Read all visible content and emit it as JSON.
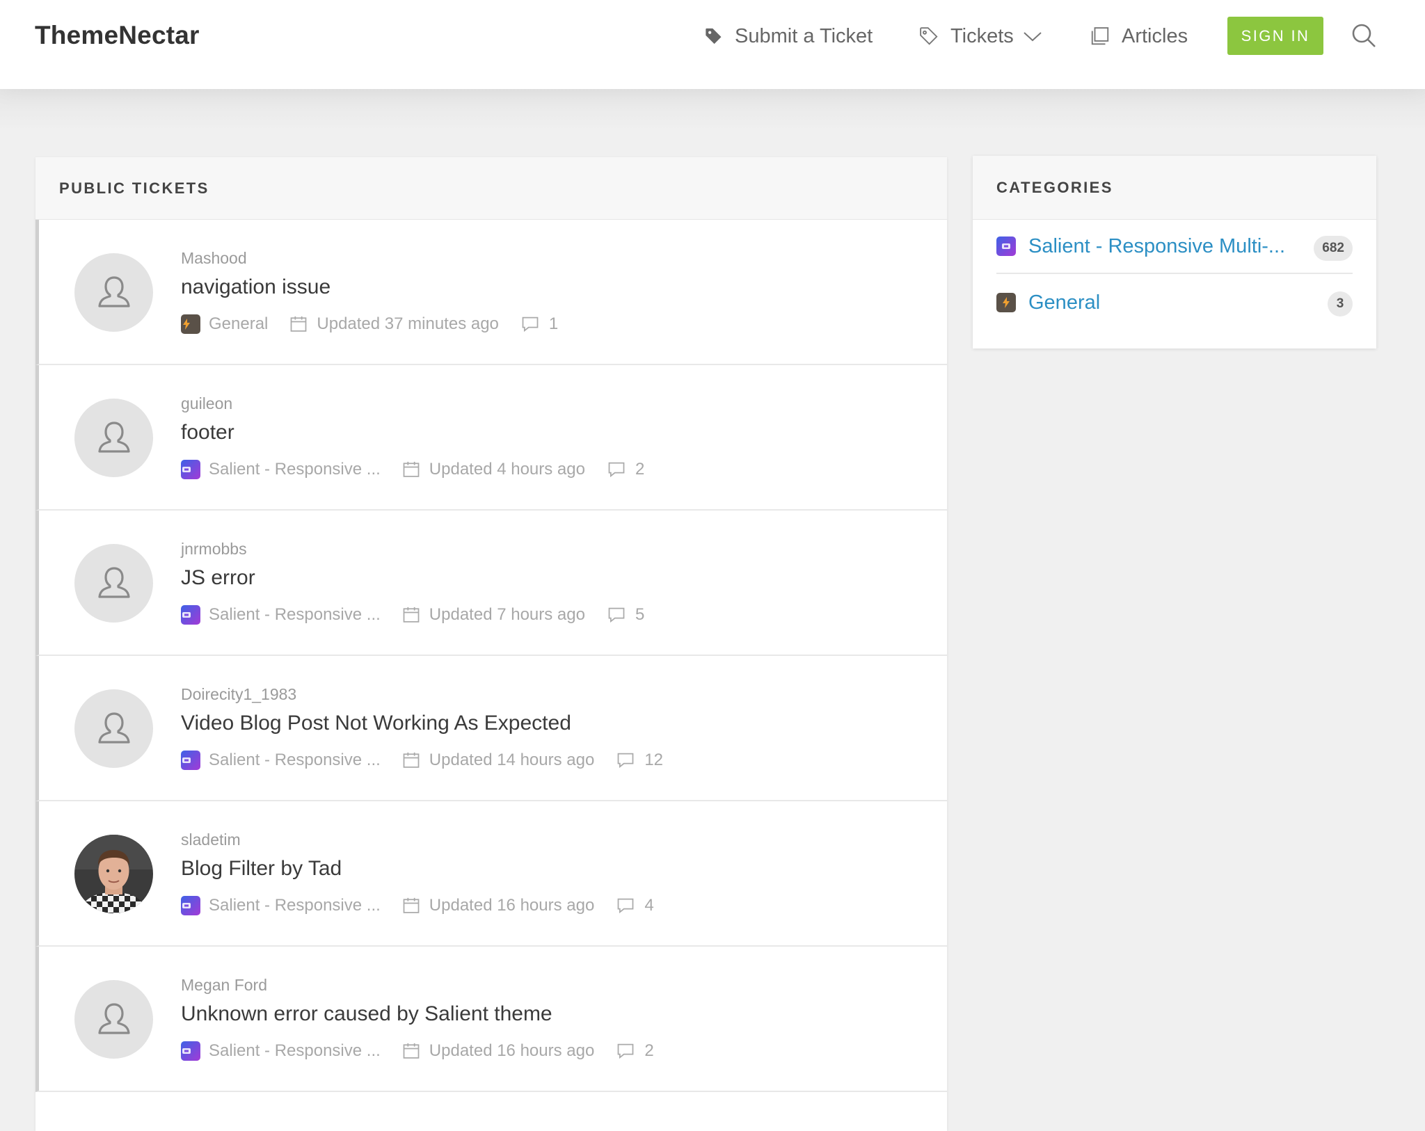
{
  "header": {
    "logo": "ThemeNectar",
    "nav": {
      "submit": "Submit a Ticket",
      "tickets": "Tickets",
      "articles": "Articles"
    },
    "signin": "SIGN IN",
    "colors": {
      "signin_bg": "#8cc63f",
      "link": "#2c8fc4"
    }
  },
  "tickets_panel": {
    "title": "PUBLIC TICKETS",
    "tickets": [
      {
        "user": "Mashood",
        "title": "navigation issue",
        "category": "General",
        "updated": "Updated 37 minutes ago",
        "comments": "1",
        "avatar": "default-avatar-icon"
      },
      {
        "user": "guileon",
        "title": "footer",
        "category": "Salient - Responsive ...",
        "updated": "Updated 4 hours ago",
        "comments": "2",
        "avatar": "default-avatar-icon"
      },
      {
        "user": "jnrmobbs",
        "title": "JS error",
        "category": "Salient - Responsive ...",
        "updated": "Updated 7 hours ago",
        "comments": "5",
        "avatar": "default-avatar-icon"
      },
      {
        "user": "Doirecity1_1983",
        "title": "Video Blog Post Not Working As Expected",
        "category": "Salient - Responsive ...",
        "updated": "Updated 14 hours ago",
        "comments": "12",
        "avatar": "default-avatar-icon"
      },
      {
        "user": "sladetim",
        "title": "Blog Filter by Tad",
        "category": "Salient - Responsive ...",
        "updated": "Updated 16 hours ago",
        "comments": "4",
        "avatar": "user-photo"
      },
      {
        "user": "Megan Ford",
        "title": "Unknown error caused by Salient theme",
        "category": "Salient - Responsive ...",
        "updated": "Updated 16 hours ago",
        "comments": "2",
        "avatar": "default-avatar-icon"
      }
    ]
  },
  "categories_panel": {
    "title": "CATEGORIES",
    "items": [
      {
        "name": "Salient - Responsive Multi-...",
        "count": "682"
      },
      {
        "name": "General",
        "count": "3"
      }
    ]
  }
}
